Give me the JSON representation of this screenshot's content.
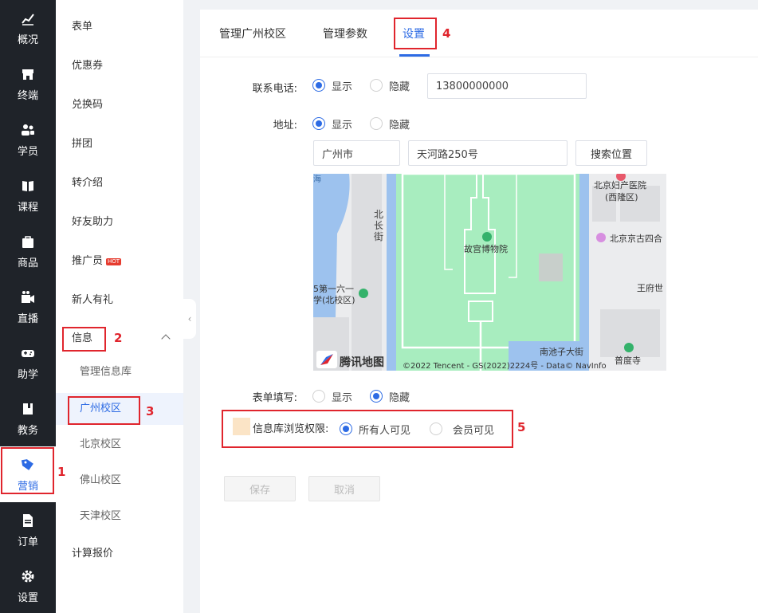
{
  "nav": {
    "items": [
      {
        "label": "概况",
        "icon": "chart-icon"
      },
      {
        "label": "终端",
        "icon": "store-icon"
      },
      {
        "label": "学员",
        "icon": "users-icon"
      },
      {
        "label": "课程",
        "icon": "book-icon"
      },
      {
        "label": "商品",
        "icon": "bag-icon"
      },
      {
        "label": "直播",
        "icon": "video-icon"
      },
      {
        "label": "助学",
        "icon": "gamepad-icon"
      },
      {
        "label": "教务",
        "icon": "notebook-icon"
      },
      {
        "label": "营销",
        "icon": "tag-icon"
      },
      {
        "label": "订单",
        "icon": "document-icon"
      },
      {
        "label": "设置",
        "icon": "gear-icon"
      }
    ],
    "active_index": 8
  },
  "submenu": {
    "items": [
      "表单",
      "优惠券",
      "兑换码",
      "拼团",
      "转介绍",
      "好友助力",
      "推广员",
      "新人有礼",
      "信息"
    ],
    "hot_badge": "HOT",
    "children": [
      "管理信息库",
      "广州校区",
      "北京校区",
      "佛山校区",
      "天津校区"
    ],
    "last": "计算报价"
  },
  "tabs": [
    "管理广州校区",
    "管理参数",
    "设置"
  ],
  "form": {
    "phone_label": "联系电话:",
    "phone_value": "13800000000",
    "address_label": "地址:",
    "show": "显示",
    "hide": "隐藏",
    "city_value": "广州市",
    "street_value": "天河路250号",
    "search_button": "搜索位置",
    "form_fill_label": "表单填写:",
    "permission_label": "信息库浏览权限:",
    "perm_everyone": "所有人可见",
    "perm_members": "会员可见",
    "save": "保存",
    "cancel": "取消"
  },
  "map": {
    "labels": {
      "hospital": "北京妇产医院",
      "district": "(西隆区)",
      "hutong": "北京京古四合",
      "street": "北长街",
      "museum": "故宫博物院",
      "school_a": "5第一六一",
      "school_b": "学(北校区)",
      "wangfu": "王府世",
      "nanchizi": "南池子大街",
      "temple": "普度寺",
      "corner": "海"
    },
    "brand": "腾讯地图",
    "copyright": "©2022 Tencent - GS(2022)2224号 - Data© NavInfo"
  },
  "annotations": [
    "1",
    "2",
    "3",
    "4",
    "5"
  ],
  "colors": {
    "accent": "#2d6be4",
    "highlight": "#e0252d"
  }
}
